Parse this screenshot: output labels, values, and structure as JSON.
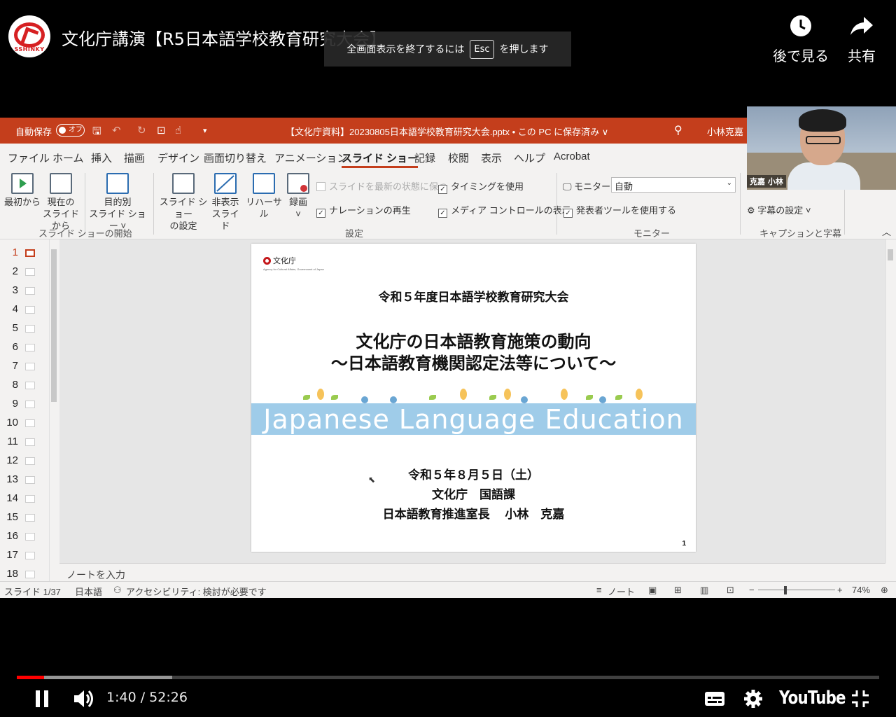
{
  "youtube": {
    "video_title": "文化庁講演【R5日本語学校教育研究大会】",
    "channel_logo_text": "SSHINKY",
    "watch_later_label": "後で見る",
    "share_label": "共有",
    "esc_toast": {
      "before": "全画面表示を終了するには",
      "key": "Esc",
      "after": "を押します"
    },
    "time_current": "1:40",
    "time_separator": "/",
    "time_total": "52:26",
    "progress_played": 0.032,
    "progress_buffered": 0.18,
    "youtube_logo": "YouTube"
  },
  "ppt": {
    "titlebar": {
      "autosave_label": "自動保存",
      "autosave_state": "オフ",
      "filename": "【文化庁資料】20230805日本語学校教育研究大会.pptx • この PC に保存済み ∨",
      "user": "小林克嘉"
    },
    "menu": [
      "ファイル",
      "ホーム",
      "挿入",
      "描画",
      "デザイン",
      "画面切り替え",
      "アニメーション",
      "スライド ショー",
      "記録",
      "校閲",
      "表示",
      "ヘルプ",
      "Acrobat"
    ],
    "ribbon": {
      "from_start": "最初から",
      "from_current_1": "現在の",
      "from_current_2": "スライドから",
      "custom_1": "目的別",
      "custom_2": "スライド ショー ˅",
      "group_start": "スライド ショーの開始",
      "setup_1": "スライド ショー",
      "setup_2": "の設定",
      "hide_1": "非表示",
      "hide_2": "スライド",
      "rehearse": "リハーサル",
      "record": "録画",
      "record_arrow": "˅",
      "keep_updated": "スライドを最新の状態に保つ",
      "play_narration": "ナレーションの再生",
      "use_timings": "タイミングを使用",
      "show_media_controls": "メディア コントロールの表示",
      "group_setup": "設定",
      "monitor_label": "モニター:",
      "monitor_value": "自動",
      "presenter_view": "発表者ツールを使用する",
      "group_monitor": "モニター",
      "subtitle_settings": "字幕の設定 ˅",
      "group_captions": "キャプションと字幕"
    },
    "thumbs": [
      "1",
      "2",
      "3",
      "4",
      "5",
      "6",
      "7",
      "8",
      "9",
      "10",
      "11",
      "12",
      "13",
      "14",
      "15",
      "16",
      "17",
      "18"
    ],
    "slide": {
      "logo": "文化庁",
      "logo_sub": "Agency for Cultural Affairs, Government of Japan",
      "event": "令和５年度日本語学校教育研究大会",
      "title_1": "文化庁の日本語教育施策の動向",
      "title_2": "～日本語教育機関認定法等について～",
      "band_text": "Japanese Language Education",
      "date": "令和５年８月５日（土）",
      "org": "文化庁　国語課",
      "speaker": "日本語教育推進室長　 小林　克嘉",
      "page": "1"
    },
    "notes_placeholder": "ノートを入力",
    "status": {
      "slide_count": "スライド 1/37",
      "language": "日本語",
      "accessibility": "アクセシビリティ: 検討が必要です",
      "notes": "ノート",
      "zoom": "74%"
    }
  },
  "webcam": {
    "name": "克嘉 小林"
  }
}
